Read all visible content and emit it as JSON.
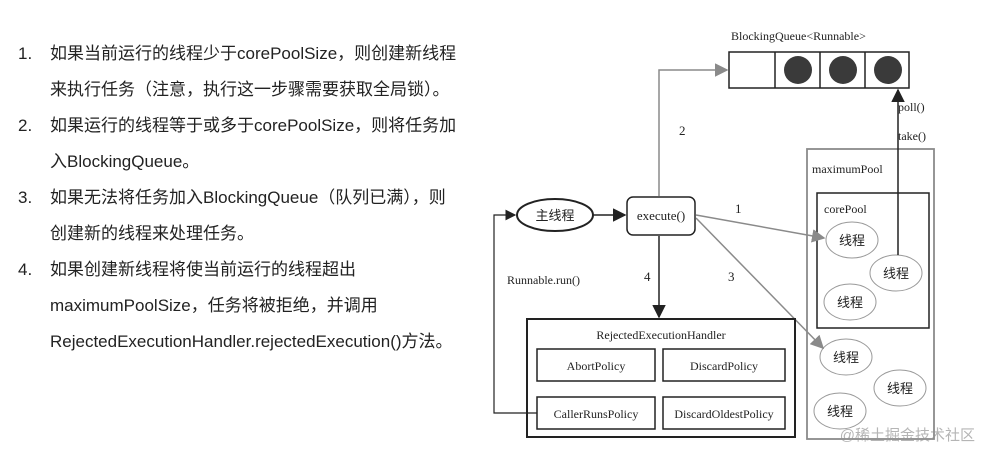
{
  "steps": [
    {
      "num": "1.",
      "text": "如果当前运行的线程少于corePoolSize，则创建新线程来执行任务（注意，执行这一步骤需要获取全局锁）。"
    },
    {
      "num": "2.",
      "text": "如果运行的线程等于或多于corePoolSize，则将任务加入BlockingQueue。"
    },
    {
      "num": "3.",
      "text": "如果无法将任务加入BlockingQueue（队列已满），则创建新的线程来处理任务。"
    },
    {
      "num": "4.",
      "text": "如果创建新线程将使当前运行的线程超出maximumPoolSize，任务将被拒绝，并调用RejectedExecutionHandler.rejectedExecution()方法。"
    }
  ],
  "diagram": {
    "queue_label": "BlockingQueue<Runnable>",
    "main_thread": "主线程",
    "execute": "execute()",
    "edge_1": "1",
    "edge_2": "2",
    "edge_3": "3",
    "edge_4": "4",
    "runnable_run": "Runnable.run()",
    "poll": "poll()",
    "take": "take()",
    "max_pool": "maximumPool",
    "core_pool": "corePool",
    "thread": "线程",
    "handler": "RejectedExecutionHandler",
    "policies": {
      "abort": "AbortPolicy",
      "discard": "DiscardPolicy",
      "caller_runs": "CallerRunsPolicy",
      "discard_oldest": "DiscardOldestPolicy"
    }
  },
  "watermark": "@稀土掘金技术社区",
  "colors": {
    "arrow_gray": "#8a8a8a",
    "dark": "#222222",
    "queue_dot": "#3a3a3a"
  }
}
